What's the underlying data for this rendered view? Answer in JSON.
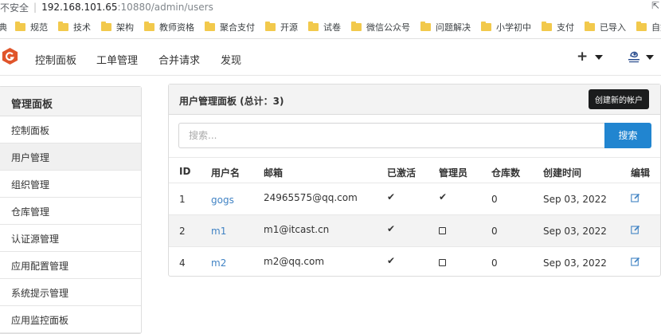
{
  "browser": {
    "insecure_label": "不安全",
    "url_host": "192.168.101.65",
    "url_path": ":10880/admin/users",
    "bookmarks": [
      "典",
      "规范",
      "技术",
      "架构",
      "教师资格",
      "聚合支付",
      "开源",
      "试卷",
      "微信公众号",
      "问题解决",
      "小学初中",
      "支付",
      "已导入",
      "自娱"
    ]
  },
  "header": {
    "nav": [
      "控制面板",
      "工单管理",
      "合并请求",
      "发现"
    ],
    "plus_label": "+"
  },
  "sidebar": {
    "title": "管理面板",
    "items": [
      "控制面板",
      "用户管理",
      "组织管理",
      "仓库管理",
      "认证源管理",
      "应用配置管理",
      "系统提示管理",
      "应用监控面板"
    ],
    "active_index": 1
  },
  "panel": {
    "title": "用户管理面板 (总计：3)",
    "create_button": "创建新的帐户",
    "search_placeholder": "搜索...",
    "search_button": "搜索"
  },
  "table": {
    "columns": [
      "ID",
      "用户名",
      "邮箱",
      "已激活",
      "管理员",
      "仓库数",
      "创建时间",
      "编辑"
    ],
    "rows": [
      {
        "id": "1",
        "username": "gogs",
        "email": "24965575@qq.com",
        "activated": true,
        "admin": true,
        "repos": "0",
        "created": "Sep 03, 2022"
      },
      {
        "id": "2",
        "username": "m1",
        "email": "m1@itcast.cn",
        "activated": true,
        "admin": false,
        "repos": "0",
        "created": "Sep 03, 2022"
      },
      {
        "id": "4",
        "username": "m2",
        "email": "m2@qq.com",
        "activated": true,
        "admin": false,
        "repos": "0",
        "created": "Sep 03, 2022"
      }
    ]
  },
  "colors": {
    "primary_button": "#2185d0",
    "link": "#4183c4",
    "logo": "#e0552b",
    "tooltip_bg": "#1b1c1d"
  }
}
